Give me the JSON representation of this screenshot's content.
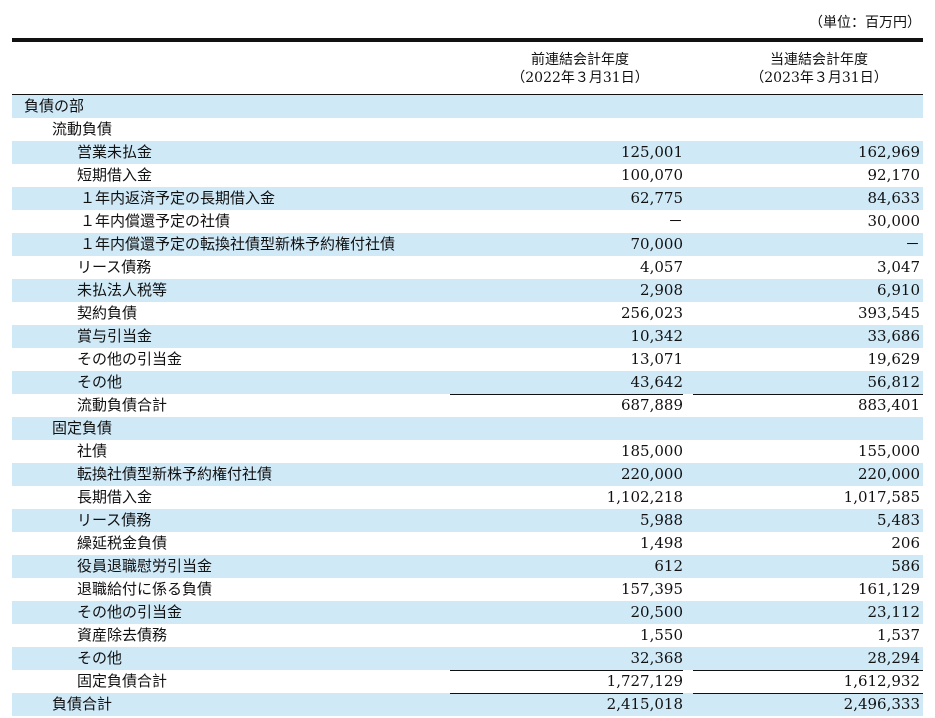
{
  "unit_note": "（単位：百万円）",
  "columns": {
    "prior": {
      "title": "前連結会計年度",
      "date": "（2022年３月31日）"
    },
    "current": {
      "title": "当連結会計年度",
      "date": "（2023年３月31日）"
    }
  },
  "rows": [
    {
      "label": "負債の部",
      "level": 0,
      "v1": "",
      "v2": "",
      "shade": true
    },
    {
      "label": "流動負債",
      "level": 1,
      "v1": "",
      "v2": "",
      "shade": false
    },
    {
      "label": "営業未払金",
      "level": 2,
      "v1": "125,001",
      "v2": "162,969",
      "shade": true
    },
    {
      "label": "短期借入金",
      "level": 2,
      "v1": "100,070",
      "v2": "92,170",
      "shade": false
    },
    {
      "label": "１年内返済予定の長期借入金",
      "level": 3,
      "v1": "62,775",
      "v2": "84,633",
      "shade": true
    },
    {
      "label": "１年内償還予定の社債",
      "level": 3,
      "v1": "－",
      "v2": "30,000",
      "shade": false
    },
    {
      "label": "１年内償還予定の転換社債型新株予約権付社債",
      "level": 3,
      "v1": "70,000",
      "v2": "－",
      "shade": true
    },
    {
      "label": "リース債務",
      "level": 2,
      "v1": "4,057",
      "v2": "3,047",
      "shade": false
    },
    {
      "label": "未払法人税等",
      "level": 2,
      "v1": "2,908",
      "v2": "6,910",
      "shade": true
    },
    {
      "label": "契約負債",
      "level": 2,
      "v1": "256,023",
      "v2": "393,545",
      "shade": false
    },
    {
      "label": "賞与引当金",
      "level": 2,
      "v1": "10,342",
      "v2": "33,686",
      "shade": true
    },
    {
      "label": "その他の引当金",
      "level": 2,
      "v1": "13,071",
      "v2": "19,629",
      "shade": false
    },
    {
      "label": "その他",
      "level": 2,
      "v1": "43,642",
      "v2": "56,812",
      "shade": true
    },
    {
      "label": "流動負債合計",
      "level": 2,
      "v1": "687,889",
      "v2": "883,401",
      "shade": false,
      "subtotal": true
    },
    {
      "label": "固定負債",
      "level": 1,
      "v1": "",
      "v2": "",
      "shade": true
    },
    {
      "label": "社債",
      "level": 2,
      "v1": "185,000",
      "v2": "155,000",
      "shade": false
    },
    {
      "label": "転換社債型新株予約権付社債",
      "level": 2,
      "v1": "220,000",
      "v2": "220,000",
      "shade": true
    },
    {
      "label": "長期借入金",
      "level": 2,
      "v1": "1,102,218",
      "v2": "1,017,585",
      "shade": false
    },
    {
      "label": "リース債務",
      "level": 2,
      "v1": "5,988",
      "v2": "5,483",
      "shade": true
    },
    {
      "label": "繰延税金負債",
      "level": 2,
      "v1": "1,498",
      "v2": "206",
      "shade": false
    },
    {
      "label": "役員退職慰労引当金",
      "level": 2,
      "v1": "612",
      "v2": "586",
      "shade": true
    },
    {
      "label": "退職給付に係る負債",
      "level": 2,
      "v1": "157,395",
      "v2": "161,129",
      "shade": false
    },
    {
      "label": "その他の引当金",
      "level": 2,
      "v1": "20,500",
      "v2": "23,112",
      "shade": true
    },
    {
      "label": "資産除去債務",
      "level": 2,
      "v1": "1,550",
      "v2": "1,537",
      "shade": false
    },
    {
      "label": "その他",
      "level": 2,
      "v1": "32,368",
      "v2": "28,294",
      "shade": true
    },
    {
      "label": "固定負債合計",
      "level": 2,
      "v1": "1,727,129",
      "v2": "1,612,932",
      "shade": false,
      "subtotal": true
    },
    {
      "label": "負債合計",
      "level": 1,
      "v1": "2,415,018",
      "v2": "2,496,333",
      "shade": true,
      "subtotal": true
    }
  ]
}
